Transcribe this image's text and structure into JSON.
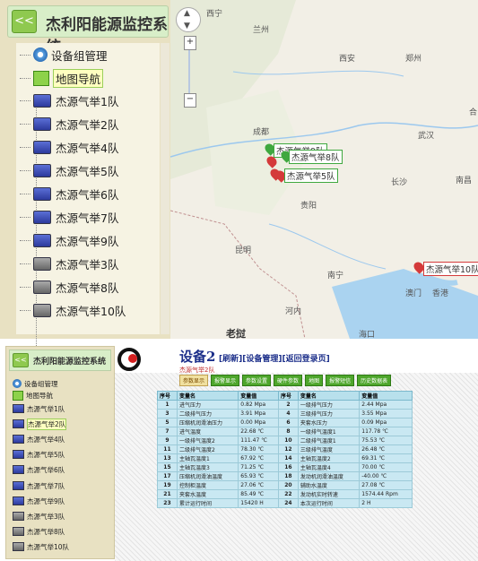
{
  "app_title": "杰利阳能源监控系统",
  "collapse_label": "<<",
  "tree": {
    "root": "设备组管理",
    "map_nav": "地图导航",
    "devices": [
      "杰源气举1队",
      "杰源气举2队",
      "杰源气举4队",
      "杰源气举5队",
      "杰源气举6队",
      "杰源气举7队",
      "杰源气举9队",
      "杰源气举3队",
      "杰源气举8队",
      "杰源气举10队"
    ]
  },
  "map": {
    "zoom_plus": "+",
    "zoom_minus": "−",
    "cities": [
      "西宁",
      "兰州",
      "西安",
      "郑州",
      "成都",
      "武汉",
      "合",
      "长沙",
      "南昌",
      "贵阳",
      "昆明",
      "南宁",
      "澳门",
      "香港",
      "河内",
      "老挝",
      "海口"
    ],
    "markers": [
      "杰源气举9队",
      "杰源气举8队",
      "杰源气举5队",
      "杰源气举10队"
    ]
  },
  "detail": {
    "title": "设备2",
    "links": "[刷新][设备管理][返回登录页]",
    "subtitle": "杰源气举2队",
    "tabs": [
      "参数显示",
      "报警显示",
      "参数设置",
      "硬件参数",
      "地图",
      "报警短信",
      "历史数据表"
    ],
    "columns": [
      "序号",
      "变量名",
      "变量值",
      "序号",
      "变量名",
      "变量值"
    ],
    "rows": [
      [
        "1",
        "进气压力",
        "0.82 Mpa",
        "2",
        "一级排气压力",
        "2.44 Mpa"
      ],
      [
        "3",
        "二级排气压力",
        "3.91 Mpa",
        "4",
        "三级排气压力",
        "3.55 Mpa"
      ],
      [
        "5",
        "压缩机润滑油压力",
        "0.00 Mpa",
        "6",
        "夹套水压力",
        "0.09 Mpa"
      ],
      [
        "7",
        "进气温度",
        "22.68 ℃",
        "8",
        "一级排气温度1",
        "117.78 ℃"
      ],
      [
        "9",
        "一级排气温度2",
        "111.47 ℃",
        "10",
        "二级排气温度1",
        "75.53 ℃"
      ],
      [
        "11",
        "二级排气温度2",
        "78.30 ℃",
        "12",
        "三级排气温度",
        "26.48 ℃"
      ],
      [
        "13",
        "主轴瓦温度1",
        "67.92 ℃",
        "14",
        "主轴瓦温度2",
        "69.31 ℃"
      ],
      [
        "15",
        "主轴瓦温度3",
        "71.25 ℃",
        "16",
        "主轴瓦温度4",
        "70.00 ℃"
      ],
      [
        "17",
        "压缩机润滑油温度",
        "65.93 ℃",
        "18",
        "发动机润滑油温度",
        "-40.00 ℃"
      ],
      [
        "19",
        "控制柜温度",
        "27.06 ℃",
        "20",
        "辅助水温度",
        "27.08 ℃"
      ],
      [
        "21",
        "夹套水温度",
        "85.49 ℃",
        "22",
        "发动机实时转速",
        "1574.44 Rpm"
      ],
      [
        "23",
        "累计运行时间",
        "15420 H",
        "24",
        "本次运行时间",
        "2 H"
      ]
    ]
  }
}
